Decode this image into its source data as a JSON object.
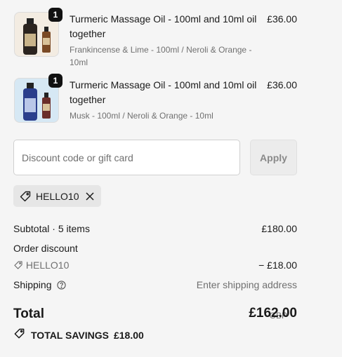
{
  "items": [
    {
      "title": "Turmeric Massage Oil - 100ml and 10ml oil together",
      "variant": "Frankincense & Lime - 100ml / Neroli & Orange - 10ml",
      "price": "£36.00",
      "quantity": "1"
    },
    {
      "title": "Turmeric Massage Oil - 100ml and 10ml oil together",
      "variant": "Musk - 100ml / Neroli & Orange - 10ml",
      "price": "£36.00",
      "quantity": "1"
    }
  ],
  "discount": {
    "placeholder": "Discount code or gift card",
    "apply_label": "Apply",
    "applied_code": "HELLO10"
  },
  "summary": {
    "subtotal_label": "Subtotal · 5 items",
    "subtotal_value": "£180.00",
    "order_discount_label": "Order discount",
    "discount_code": "HELLO10",
    "discount_value": "− £18.00",
    "shipping_label": "Shipping",
    "shipping_value": "Enter shipping address",
    "total_label": "Total",
    "currency": "GBP",
    "total_value": "£162.00",
    "savings_label": "TOTAL SAVINGS",
    "savings_value": "£18.00"
  },
  "icons": {
    "tag": "tag-icon",
    "remove": "close-icon",
    "help": "question-circle-icon"
  }
}
